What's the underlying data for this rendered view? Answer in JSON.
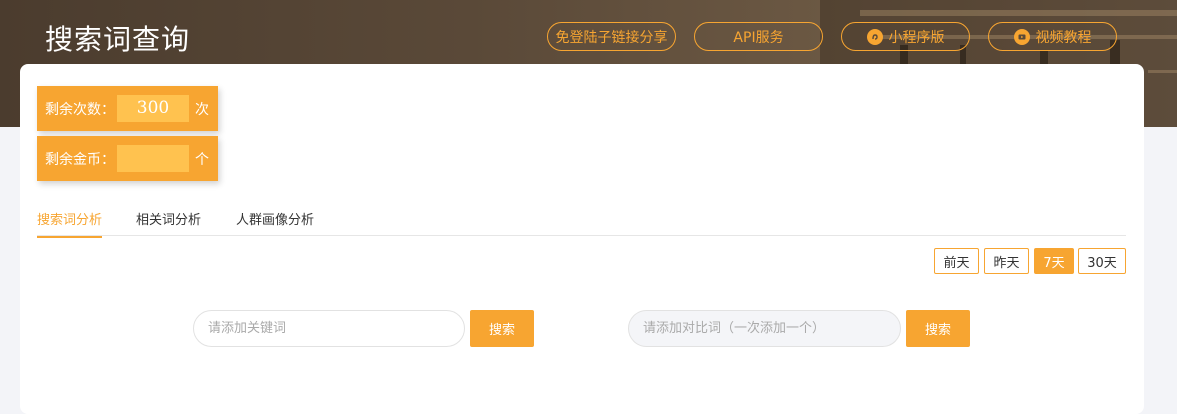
{
  "header": {
    "title": "搜索词查询",
    "links": [
      {
        "label": "免登陆子链接分享",
        "icon": ""
      },
      {
        "label": "API服务",
        "icon": ""
      },
      {
        "label": "小程序版",
        "icon": "mini-program-icon"
      },
      {
        "label": "视频教程",
        "icon": "video-icon"
      }
    ]
  },
  "quota": {
    "remaining_times": {
      "label": "剩余次数：",
      "value": "300",
      "unit": "次"
    },
    "remaining_coins": {
      "label": "剩余金币：",
      "value": "",
      "unit": "个"
    }
  },
  "tabs": [
    {
      "label": "搜索词分析",
      "active": true
    },
    {
      "label": "相关词分析",
      "active": false
    },
    {
      "label": "人群画像分析",
      "active": false
    }
  ],
  "date_range": {
    "options": [
      "前天",
      "昨天",
      "7天",
      "30天"
    ],
    "selected": "7天"
  },
  "search": {
    "keyword_placeholder": "请添加关键词",
    "keyword_button": "搜索",
    "compare_placeholder": "请添加对比词（一次添加一个）",
    "compare_button": "搜索"
  },
  "colors": {
    "accent": "#f7a531",
    "accent_light": "#ffc24f",
    "banner": "#5a4938"
  }
}
